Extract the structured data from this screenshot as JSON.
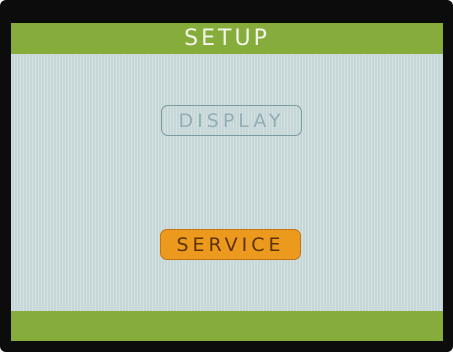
{
  "header": {
    "title": "SETUP"
  },
  "menu": {
    "items": [
      {
        "label": "DISPLAY",
        "selected": false
      },
      {
        "label": "SERVICE",
        "selected": true
      }
    ]
  },
  "colors": {
    "bar_green": "#86ad3c",
    "screen_background": "#ccdcdc",
    "selected_fill": "#eb9a1d",
    "unselected_outline": "#7c9aa2"
  }
}
